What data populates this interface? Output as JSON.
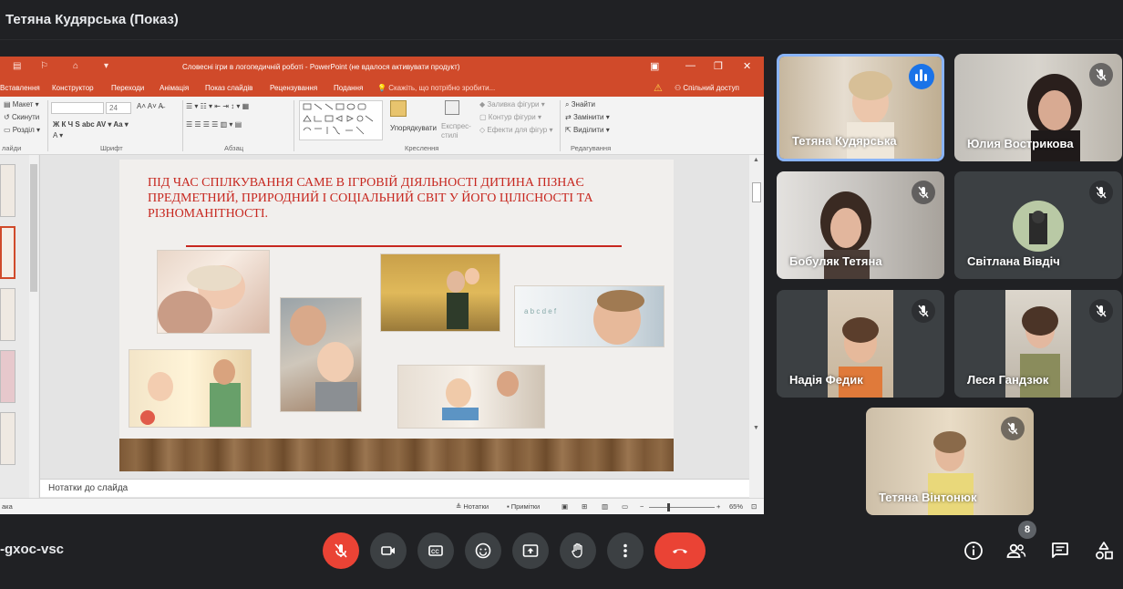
{
  "meeting": {
    "presenter_title": "Тетяна Кудярська (Показ)",
    "code": "-gxoc-vsc",
    "participant_count": "8"
  },
  "powerpoint": {
    "doc_title": "Словесні ігри в логопедичній роботі - PowerPoint (не вдалося активувати продукт)",
    "tabs": [
      "Вставлення",
      "Конструктор",
      "Переходи",
      "Анімація",
      "Показ слайдів",
      "Рецензування",
      "Подання"
    ],
    "tell_me": "Скажіть, що потрібно зробити...",
    "share": "Спільний доступ",
    "ribbon": {
      "slides_items": [
        "Макет",
        "Скинути",
        "Розділ"
      ],
      "group_slides": "лайди",
      "group_font": "Шрифт",
      "group_paragraph": "Абзац",
      "group_drawing": "Креслення",
      "group_editing": "Редагування",
      "font_size": "24",
      "arrange": "Упорядкувати",
      "quick_styles": "Експрес-стилі",
      "shape_fill": "Заливка фігури",
      "shape_outline": "Контур фігури",
      "shape_effects": "Ефекти для фігур",
      "find": "Знайти",
      "replace": "Замінити",
      "select": "Виділити"
    },
    "slide_text": "ПІД ЧАС СПІЛКУВАННЯ САМЕ В ІГРОВІЙ ДІЯЛЬНОСТІ ДИТИНА ПІЗНАЄ ПРЕДМЕТНИЙ, ПРИРОДНИЙ І СОЦІАЛЬНИЙ СВІТ У ЙОГО ЦІЛІСНОСТІ ТА РІЗНОМАНІТНОСТІ.",
    "notes_label": "Нотатки до слайда",
    "status": {
      "left": "ака",
      "notes": "Нотатки",
      "comments": "Примітки",
      "zoom": "65%"
    }
  },
  "participants": [
    {
      "name": "Тетяна Кудярська",
      "speaking": true
    },
    {
      "name": "Юлия Вострикова",
      "muted": true
    },
    {
      "name": "Бобуляк Тетяна",
      "muted": true
    },
    {
      "name": "Світлана Вівдіч",
      "muted": true
    },
    {
      "name": "Надія Федик",
      "muted": true
    },
    {
      "name": "Леся Гандзюк",
      "muted": true
    },
    {
      "name": "Тетяна Вінтонюк",
      "muted": true
    }
  ],
  "colors": {
    "accent": "#8ab4f8",
    "end_call": "#ea4335",
    "powerpoint": "#d04a2a",
    "slide_text": "#c7271f"
  }
}
